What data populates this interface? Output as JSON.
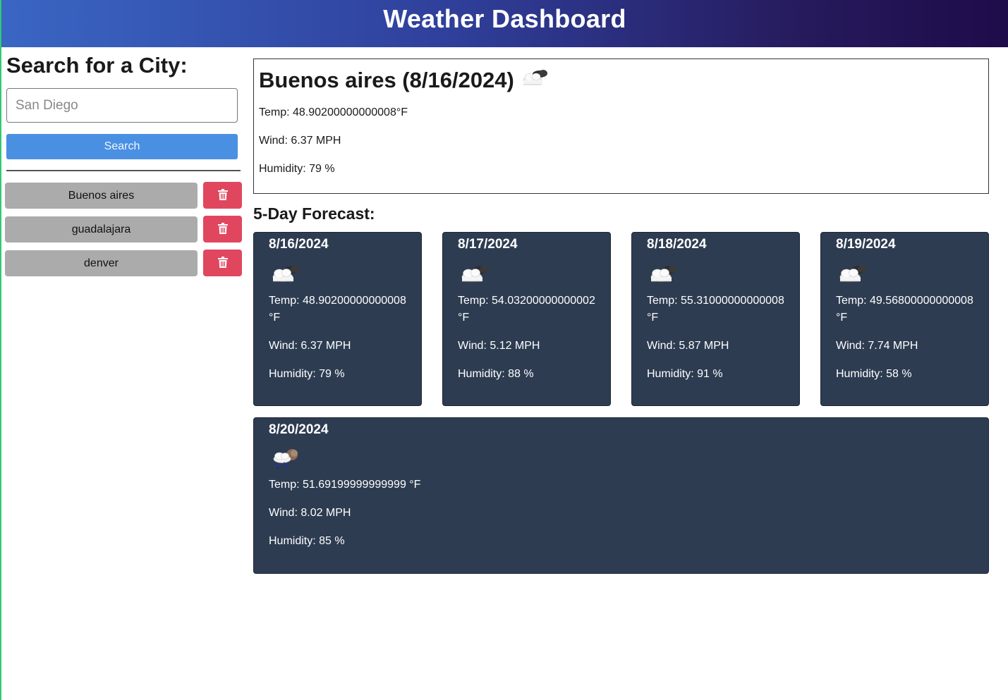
{
  "header": {
    "title": "Weather Dashboard"
  },
  "sidebar": {
    "heading": "Search for a City:",
    "search": {
      "placeholder": "San Diego",
      "value": "",
      "button_label": "Search"
    },
    "history": [
      {
        "city": "Buenos aires",
        "delete_icon": "trash-icon"
      },
      {
        "city": "guadalajara",
        "delete_icon": "trash-icon"
      },
      {
        "city": "denver",
        "delete_icon": "trash-icon"
      }
    ]
  },
  "current": {
    "title": "Buenos aires (8/16/2024)",
    "icon": "night-cloudy-icon",
    "temp": "Temp: 48.90200000000008°F",
    "wind": "Wind: 6.37 MPH",
    "humidity": "Humidity: 79 %"
  },
  "forecast": {
    "heading": "5-Day Forecast:",
    "days": [
      {
        "date": "8/16/2024",
        "icon": "night-cloudy-icon",
        "temp": "Temp: 48.90200000000008 °F",
        "wind": "Wind: 6.37 MPH",
        "humidity": "Humidity: 79 %"
      },
      {
        "date": "8/17/2024",
        "icon": "night-cloudy-icon",
        "temp": "Temp: 54.03200000000002 °F",
        "wind": "Wind: 5.12 MPH",
        "humidity": "Humidity: 88 %"
      },
      {
        "date": "8/18/2024",
        "icon": "night-cloudy-icon",
        "temp": "Temp: 55.31000000000008 °F",
        "wind": "Wind: 5.87 MPH",
        "humidity": "Humidity: 91 %"
      },
      {
        "date": "8/19/2024",
        "icon": "night-cloudy-icon",
        "temp": "Temp: 49.56800000000008 °F",
        "wind": "Wind: 7.74 MPH",
        "humidity": "Humidity: 58 %"
      },
      {
        "date": "8/20/2024",
        "icon": "night-rain-icon",
        "temp": "Temp: 51.69199999999999 °F",
        "wind": "Wind: 8.02 MPH",
        "humidity": "Humidity: 85 %"
      }
    ]
  },
  "colors": {
    "header_gradient_start": "#3a66c4",
    "header_gradient_end": "#1e0b4a",
    "search_button": "#4a90e2",
    "history_button": "#ababab",
    "delete_button": "#e0475f",
    "card_background": "#2d3c51"
  }
}
